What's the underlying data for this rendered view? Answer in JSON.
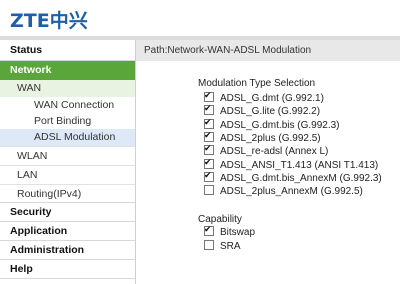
{
  "brand": {
    "logo_text": "ZTE中兴"
  },
  "nav": {
    "status": "Status",
    "network": "Network",
    "wan": "WAN",
    "wan_connection": "WAN Connection",
    "port_binding": "Port Binding",
    "adsl_modulation": "ADSL Modulation",
    "wlan": "WLAN",
    "lan": "LAN",
    "routing": "Routing(IPv4)",
    "security": "Security",
    "application": "Application",
    "administration": "Administration",
    "help": "Help"
  },
  "path": "Path:Network-WAN-ADSL Modulation",
  "modulation": {
    "heading": "Modulation Type Selection",
    "options": [
      {
        "label": "ADSL_G.dmt (G.992.1)",
        "checked": true
      },
      {
        "label": "ADSL_G.lite (G.992.2)",
        "checked": true
      },
      {
        "label": "ADSL_G.dmt.bis (G.992.3)",
        "checked": true
      },
      {
        "label": "ADSL_2plus (G.992.5)",
        "checked": true
      },
      {
        "label": "ADSL_re-adsl (Annex L)",
        "checked": true
      },
      {
        "label": "ADSL_ANSI_T1.413 (ANSI T1.413)",
        "checked": true
      },
      {
        "label": "ADSL_G.dmt.bis_AnnexM (G.992.3)",
        "checked": true
      },
      {
        "label": "ADSL_2plus_AnnexM (G.992.5)",
        "checked": false
      }
    ]
  },
  "capability": {
    "heading": "Capability",
    "options": [
      {
        "label": "Bitswap",
        "checked": true
      },
      {
        "label": "SRA",
        "checked": false
      }
    ]
  }
}
